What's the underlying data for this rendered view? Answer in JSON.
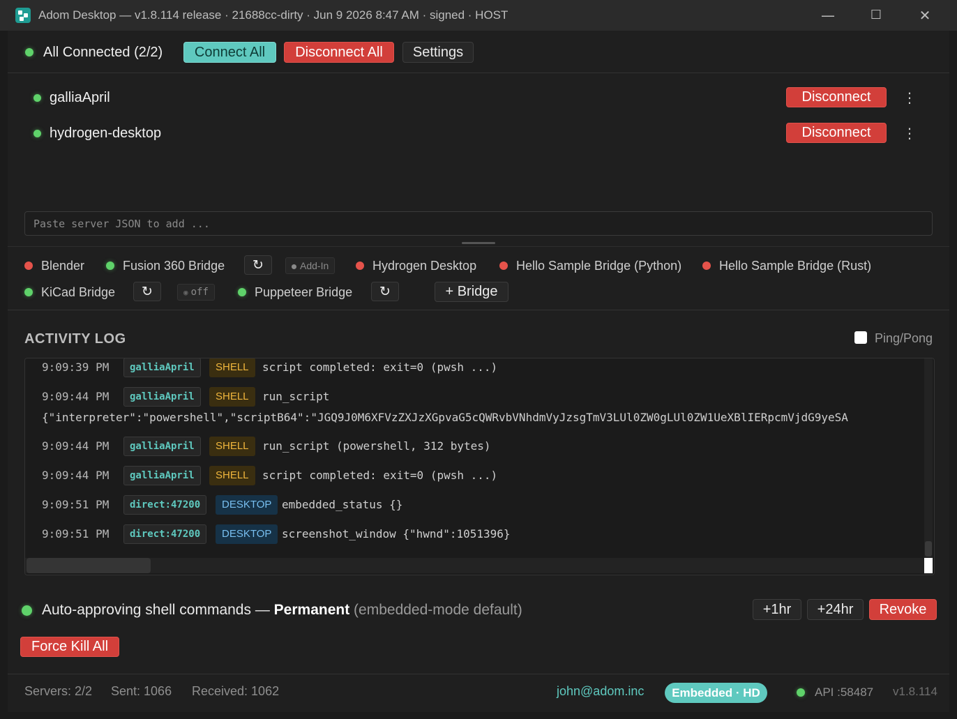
{
  "window": {
    "title": "Adom Desktop — v1.8.114 release · 21688cc-dirty · Jun 9 2026 8:47 AM · signed · HOST",
    "minimize_glyph": "—",
    "maximize_glyph": "☐",
    "close_glyph": "✕"
  },
  "toolbar": {
    "status": "All Connected (2/2)",
    "connect_all": "Connect All",
    "disconnect_all": "Disconnect All",
    "settings": "Settings"
  },
  "servers": [
    {
      "name": "galliaApril",
      "status": "connected",
      "action": "Disconnect"
    },
    {
      "name": "hydrogen-desktop",
      "status": "connected",
      "action": "Disconnect"
    }
  ],
  "paste_input": {
    "placeholder": "Paste server JSON to add ..."
  },
  "bridges": {
    "blender": {
      "name": "Blender",
      "status": "disconnected"
    },
    "fusion": {
      "name": "Fusion 360 Bridge",
      "status": "connected",
      "reload": "↻",
      "tag": "Add-In"
    },
    "hydrogen": {
      "name": "Hydrogen Desktop",
      "status": "disconnected"
    },
    "hello_python": {
      "name": "Hello Sample Bridge (Python)",
      "status": "disconnected"
    },
    "hello_rust": {
      "name": "Hello Sample Bridge (Rust)",
      "status": "disconnected"
    },
    "kicad": {
      "name": "KiCad Bridge",
      "status": "connected",
      "reload": "↻",
      "tag": "off"
    },
    "puppeteer": {
      "name": "Puppeteer Bridge",
      "status": "connected",
      "reload": "↻"
    },
    "add_bridge": "+ Bridge"
  },
  "activity_log": {
    "title": "ACTIVITY LOG",
    "ping_pong_label": "Ping/Pong",
    "ping_pong_checked": false,
    "entries": [
      {
        "time": "9:09:39 PM",
        "source": "galliaApril",
        "type": "SHELL",
        "message": "script completed: exit=0 (pwsh  ...)"
      },
      {
        "time": "9:09:44 PM",
        "source": "galliaApril",
        "type": "SHELL",
        "message": "run_script",
        "continuation": "{\"interpreter\":\"powershell\",\"scriptB64\":\"JGQ9J0M6XFVzZXJzXGpvaG5cQWRvbVNhdmVyJzsgTmV3LUl0ZW0gLUl0ZW1UeXBlIERpcmVjdG9yeSA"
      },
      {
        "time": "9:09:44 PM",
        "source": "galliaApril",
        "type": "SHELL",
        "message": "run_script (powershell, 312 bytes)"
      },
      {
        "time": "9:09:44 PM",
        "source": "galliaApril",
        "type": "SHELL",
        "message": "script completed: exit=0 (pwsh  ...)"
      },
      {
        "time": "9:09:51 PM",
        "source": "direct:47200",
        "type": "DESKTOP",
        "message": "embedded_status {}"
      },
      {
        "time": "9:09:51 PM",
        "source": "direct:47200",
        "type": "DESKTOP",
        "message": "screenshot_window {\"hwnd\":1051396}"
      }
    ]
  },
  "approval": {
    "text": "Auto-approving shell commands — ",
    "mode": "Permanent",
    "suffix": " (embedded-mode default)",
    "plus_1hr": "+1hr",
    "plus_24hr": "+24hr",
    "revoke": "Revoke"
  },
  "force_kill": "Force Kill All",
  "footer": {
    "servers": "Servers: 2/2",
    "sent": "Sent: 1066",
    "received": "Received: 1062",
    "user": "john@adom.inc",
    "mode_badge": "Embedded · HD",
    "api": "API :58487",
    "version": "v1.8.114"
  },
  "colors": {
    "accent_teal": "#5fc9bf",
    "danger_red": "#d23f3a",
    "status_green": "#5fd26a",
    "status_red": "#e5534b",
    "shell_amber": "#f0b63c",
    "desktop_blue": "#78bff0"
  }
}
